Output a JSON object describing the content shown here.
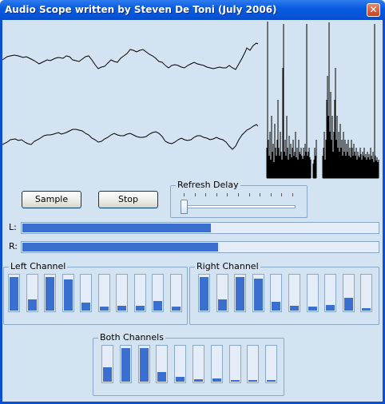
{
  "window": {
    "title": "Audio Scope written by Steven De Toni (July 2006)",
    "close_label": "✕"
  },
  "buttons": {
    "sample_label": "Sample",
    "stop_label": "Stop"
  },
  "refresh_delay": {
    "label": "Refresh Delay",
    "value": 0.0,
    "ticks": 11
  },
  "levels": {
    "left": {
      "label": "L:",
      "value": 0.53
    },
    "right": {
      "label": "R:",
      "value": 0.55
    }
  },
  "left_channel": {
    "label": "Left Channel",
    "bands": [
      0.95,
      0.32,
      0.95,
      0.88,
      0.22,
      0.12,
      0.14,
      0.14,
      0.28,
      0.12
    ]
  },
  "right_channel": {
    "label": "Right Channel",
    "bands": [
      0.95,
      0.32,
      0.95,
      0.92,
      0.24,
      0.14,
      0.12,
      0.16,
      0.36,
      0.06
    ]
  },
  "both_channels": {
    "label": "Both Channels",
    "bands": [
      0.42,
      0.95,
      0.95,
      0.28,
      0.14,
      0.06,
      0.1,
      0.04,
      0.04,
      0.04
    ]
  }
}
